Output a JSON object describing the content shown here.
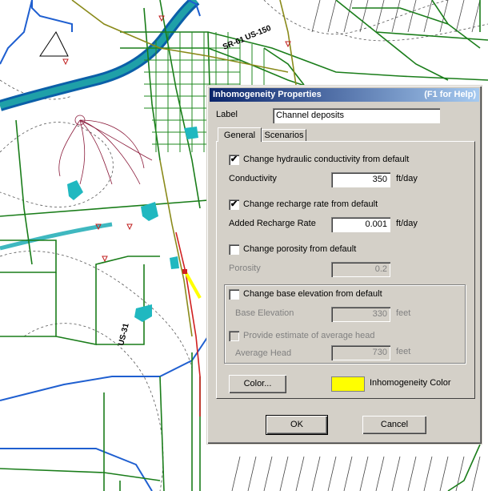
{
  "dialog": {
    "title": "Inhomogeneity Properties",
    "help": "(F1 for Help)",
    "label_caption": "Label",
    "label_value": "Channel deposits",
    "tabs": [
      "General",
      "Scenarios"
    ],
    "conductivity": {
      "checkbox_label": "Change hydraulic conductivity from default",
      "checked": true,
      "field_label": "Conductivity",
      "value": "350",
      "unit": "ft/day"
    },
    "recharge": {
      "checkbox_label": "Change recharge rate from default",
      "checked": true,
      "field_label": "Added Recharge Rate",
      "value": "0.001",
      "unit": "ft/day"
    },
    "porosity": {
      "checkbox_label": "Change porosity from default",
      "checked": false,
      "field_label": "Porosity",
      "value": "0.2"
    },
    "base_elevation": {
      "checkbox_label": "Change base elevation from default",
      "checked": false,
      "field_label": "Base Elevation",
      "value": "330",
      "unit": "feet",
      "avg_checkbox_label": "Provide estimate of average head",
      "avg_field_label": "Average Head",
      "avg_value": "730",
      "avg_unit": "feet"
    },
    "color_button": "Color...",
    "color_caption": "Inhomogeneity Color",
    "color_value": "#ffff00",
    "ok": "OK",
    "cancel": "Cancel"
  },
  "map": {
    "route_labels": [
      "SR-61",
      "US-150",
      "US-31"
    ]
  }
}
